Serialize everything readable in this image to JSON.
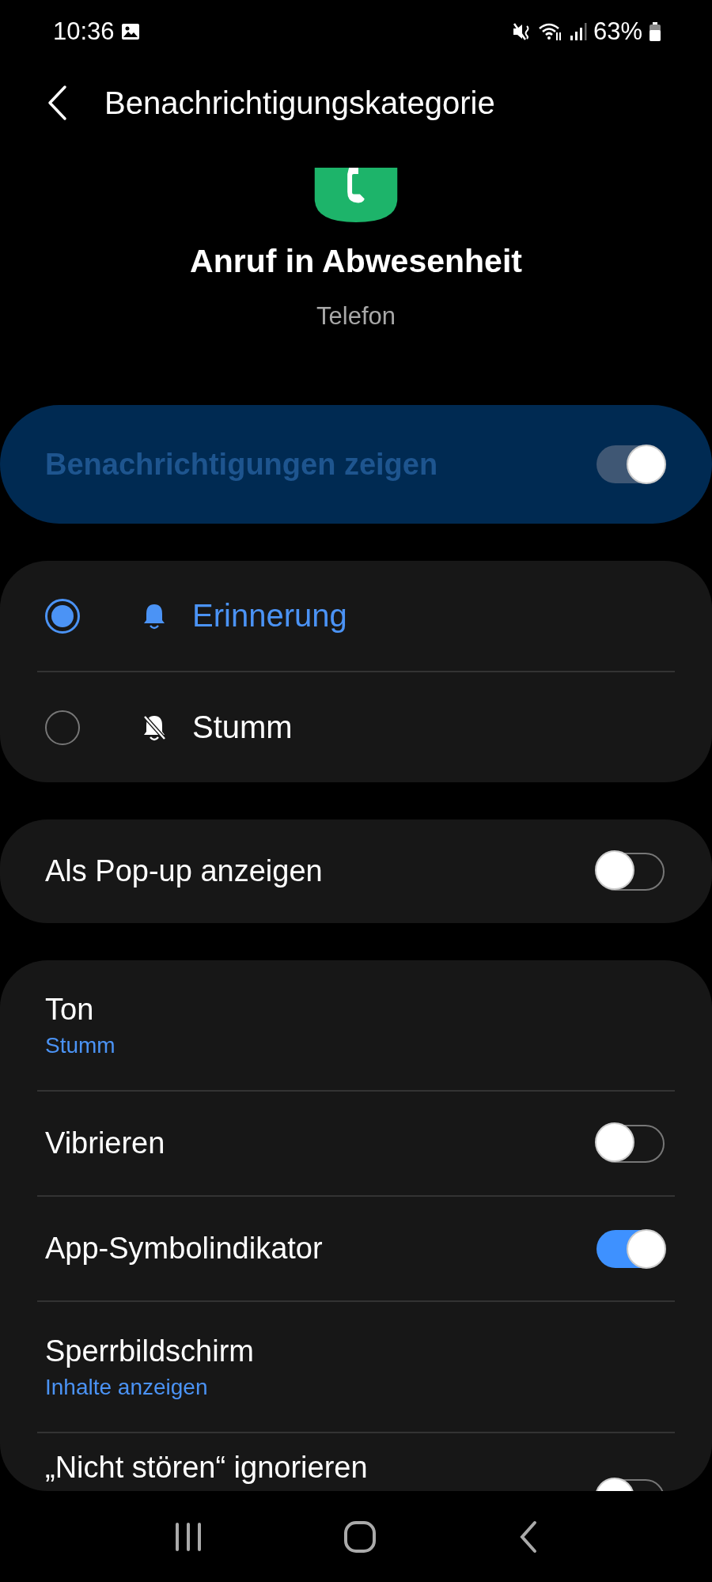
{
  "status_bar": {
    "time": "10:36",
    "battery": "63%"
  },
  "header": {
    "title": "Benachrichtigungskategorie"
  },
  "app": {
    "title": "Anruf in Abwesenheit",
    "subtitle": "Telefon"
  },
  "master_switch": {
    "label": "Benachrichtigungen zeigen",
    "on": true
  },
  "alert_options": [
    {
      "label": "Erinnerung",
      "kind": "bell",
      "selected": true
    },
    {
      "label": "Stumm",
      "kind": "bell-off",
      "selected": false
    }
  ],
  "popup": {
    "label": "Als Pop-up anzeigen",
    "on": false
  },
  "settings": [
    {
      "label": "Ton",
      "kind": "value",
      "value": "Stumm"
    },
    {
      "label": "Vibrieren",
      "kind": "switch",
      "on": false
    },
    {
      "label": "App-Symbolindikator",
      "kind": "switch",
      "on": true
    },
    {
      "label": "Sperrbildschirm",
      "kind": "value",
      "value": "Inhalte anzeigen"
    },
    {
      "label": "„Nicht stören“ ignorieren",
      "kind": "switch",
      "on": false
    }
  ]
}
